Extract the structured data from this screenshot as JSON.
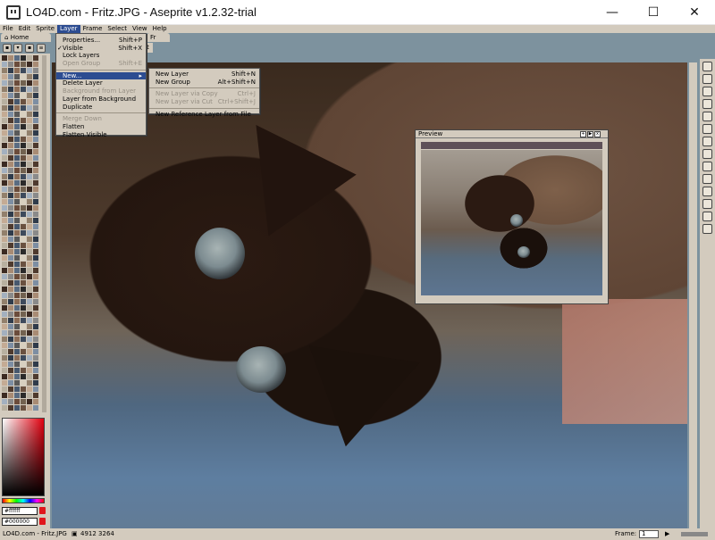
{
  "window": {
    "title": "LO4D.com - Fritz.JPG - Aseprite v1.2.32-trial",
    "minimize_glyph": "—",
    "maximize_glyph": "☐",
    "close_glyph": "✕"
  },
  "menubar": [
    "File",
    "Edit",
    "Sprite",
    "Layer",
    "Frame",
    "Select",
    "View",
    "Help"
  ],
  "tabs": {
    "home": "Home",
    "file": "Fr"
  },
  "toolbar": {
    "frame_strip_label": "ect"
  },
  "layer_menu": {
    "items": [
      {
        "label": "Properties...",
        "shortcut": "Shift+P",
        "state": "enabled"
      },
      {
        "label": "Visible",
        "shortcut": "Shift+X",
        "state": "checked"
      },
      {
        "label": "Lock Layers",
        "shortcut": "",
        "state": "enabled"
      },
      {
        "label": "Open Group",
        "shortcut": "Shift+E",
        "state": "disabled"
      },
      {
        "label": "New...",
        "shortcut": "",
        "state": "highlighted"
      },
      {
        "label": "Delete Layer",
        "shortcut": "",
        "state": "enabled"
      },
      {
        "label": "Background from Layer",
        "shortcut": "",
        "state": "disabled"
      },
      {
        "label": "Layer from Background",
        "shortcut": "",
        "state": "enabled"
      },
      {
        "label": "Duplicate",
        "shortcut": "",
        "state": "enabled"
      },
      {
        "label": "Merge Down",
        "shortcut": "",
        "state": "disabled"
      },
      {
        "label": "Flatten",
        "shortcut": "",
        "state": "enabled"
      },
      {
        "label": "Flatten Visible",
        "shortcut": "",
        "state": "enabled"
      }
    ]
  },
  "new_submenu": {
    "items": [
      {
        "label": "New Layer",
        "shortcut": "Shift+N",
        "state": "enabled"
      },
      {
        "label": "New Group",
        "shortcut": "Alt+Shift+N",
        "state": "enabled"
      },
      {
        "label": "New Layer via Copy",
        "shortcut": "Ctrl+J",
        "state": "disabled"
      },
      {
        "label": "New Layer via Cut",
        "shortcut": "Ctrl+Shift+J",
        "state": "disabled"
      },
      {
        "label": "New Reference Layer from File",
        "shortcut": "",
        "state": "enabled"
      }
    ]
  },
  "color_bar": {
    "fg_color": "#ffffff",
    "bg_color": "#000000"
  },
  "preview": {
    "title": "Preview"
  },
  "status": {
    "file": "LO4D.com - Fritz.JPG",
    "size": "4912 3264",
    "frame_label": "Frame:",
    "frame_value": "1"
  },
  "colors": {
    "menu_bg": "#d3cbbe",
    "highlight": "#2c4c91",
    "workspace": "#7d929e"
  }
}
